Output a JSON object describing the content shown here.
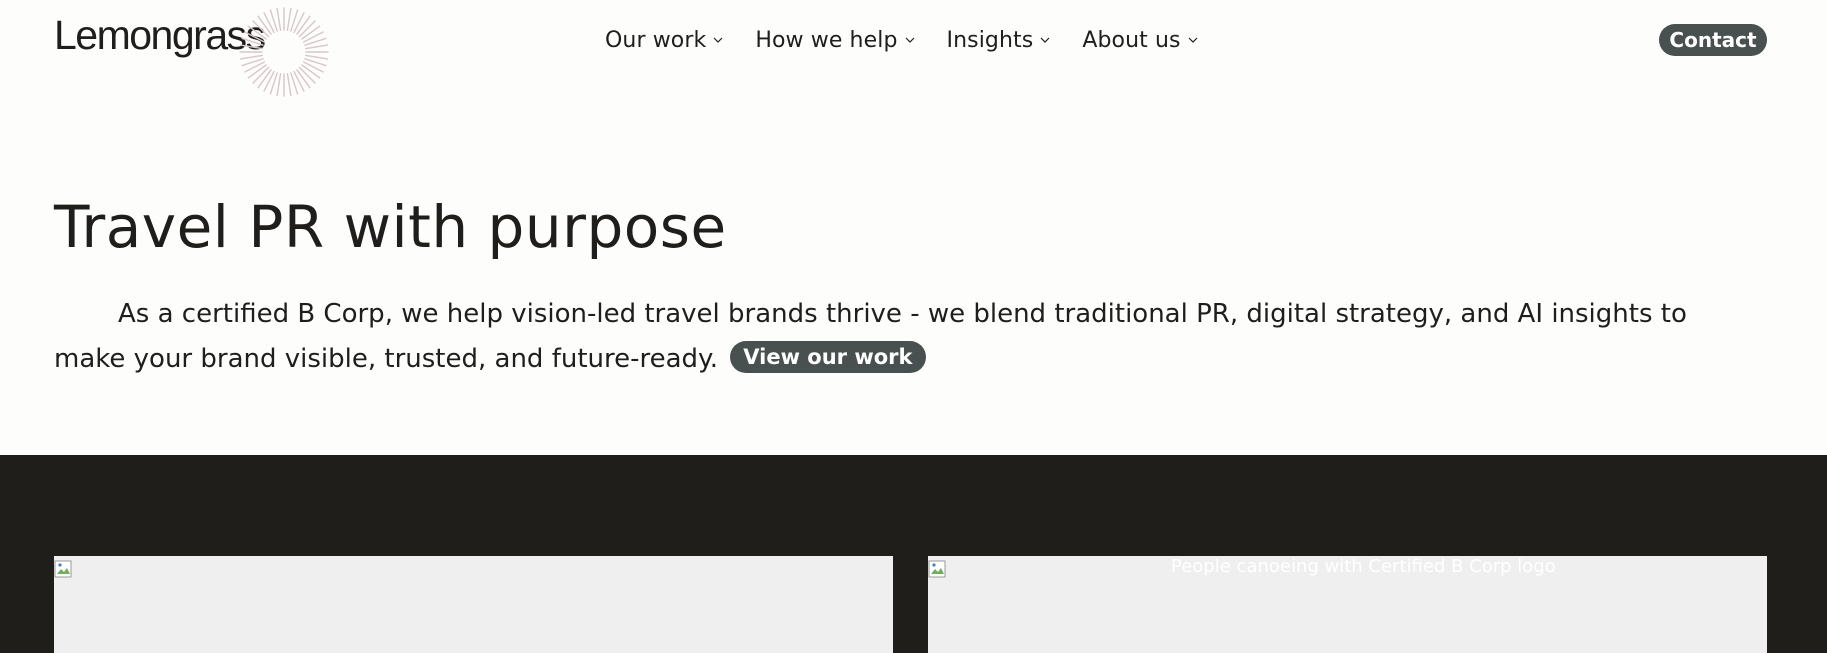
{
  "brand": {
    "name": "Lemongrass"
  },
  "nav": {
    "items": [
      {
        "label": "Our work"
      },
      {
        "label": "How we help"
      },
      {
        "label": "Insights"
      },
      {
        "label": "About us"
      }
    ],
    "contact_label": "Contact"
  },
  "hero": {
    "title": "Travel PR with purpose",
    "body": "As a certified B Corp, we help vision-led travel brands thrive - we blend traditional PR, digital strategy, and AI insights to make your brand visible, trusted, and future-ready.",
    "cta_label": "View our work"
  },
  "gallery": {
    "right_image_alt": "People canoeing with Certified B Corp logo"
  },
  "colors": {
    "text": "#1f1e1b",
    "button_bg": "#48514f",
    "dark_band": "#1f1e1b",
    "image_placeholder": "#efefef",
    "logo_burst": "#d8c6cb"
  },
  "icons": {
    "nav_chevron": "chevron-down-icon",
    "broken_image": "broken-image-icon",
    "logo_mark": "sunburst-icon"
  }
}
